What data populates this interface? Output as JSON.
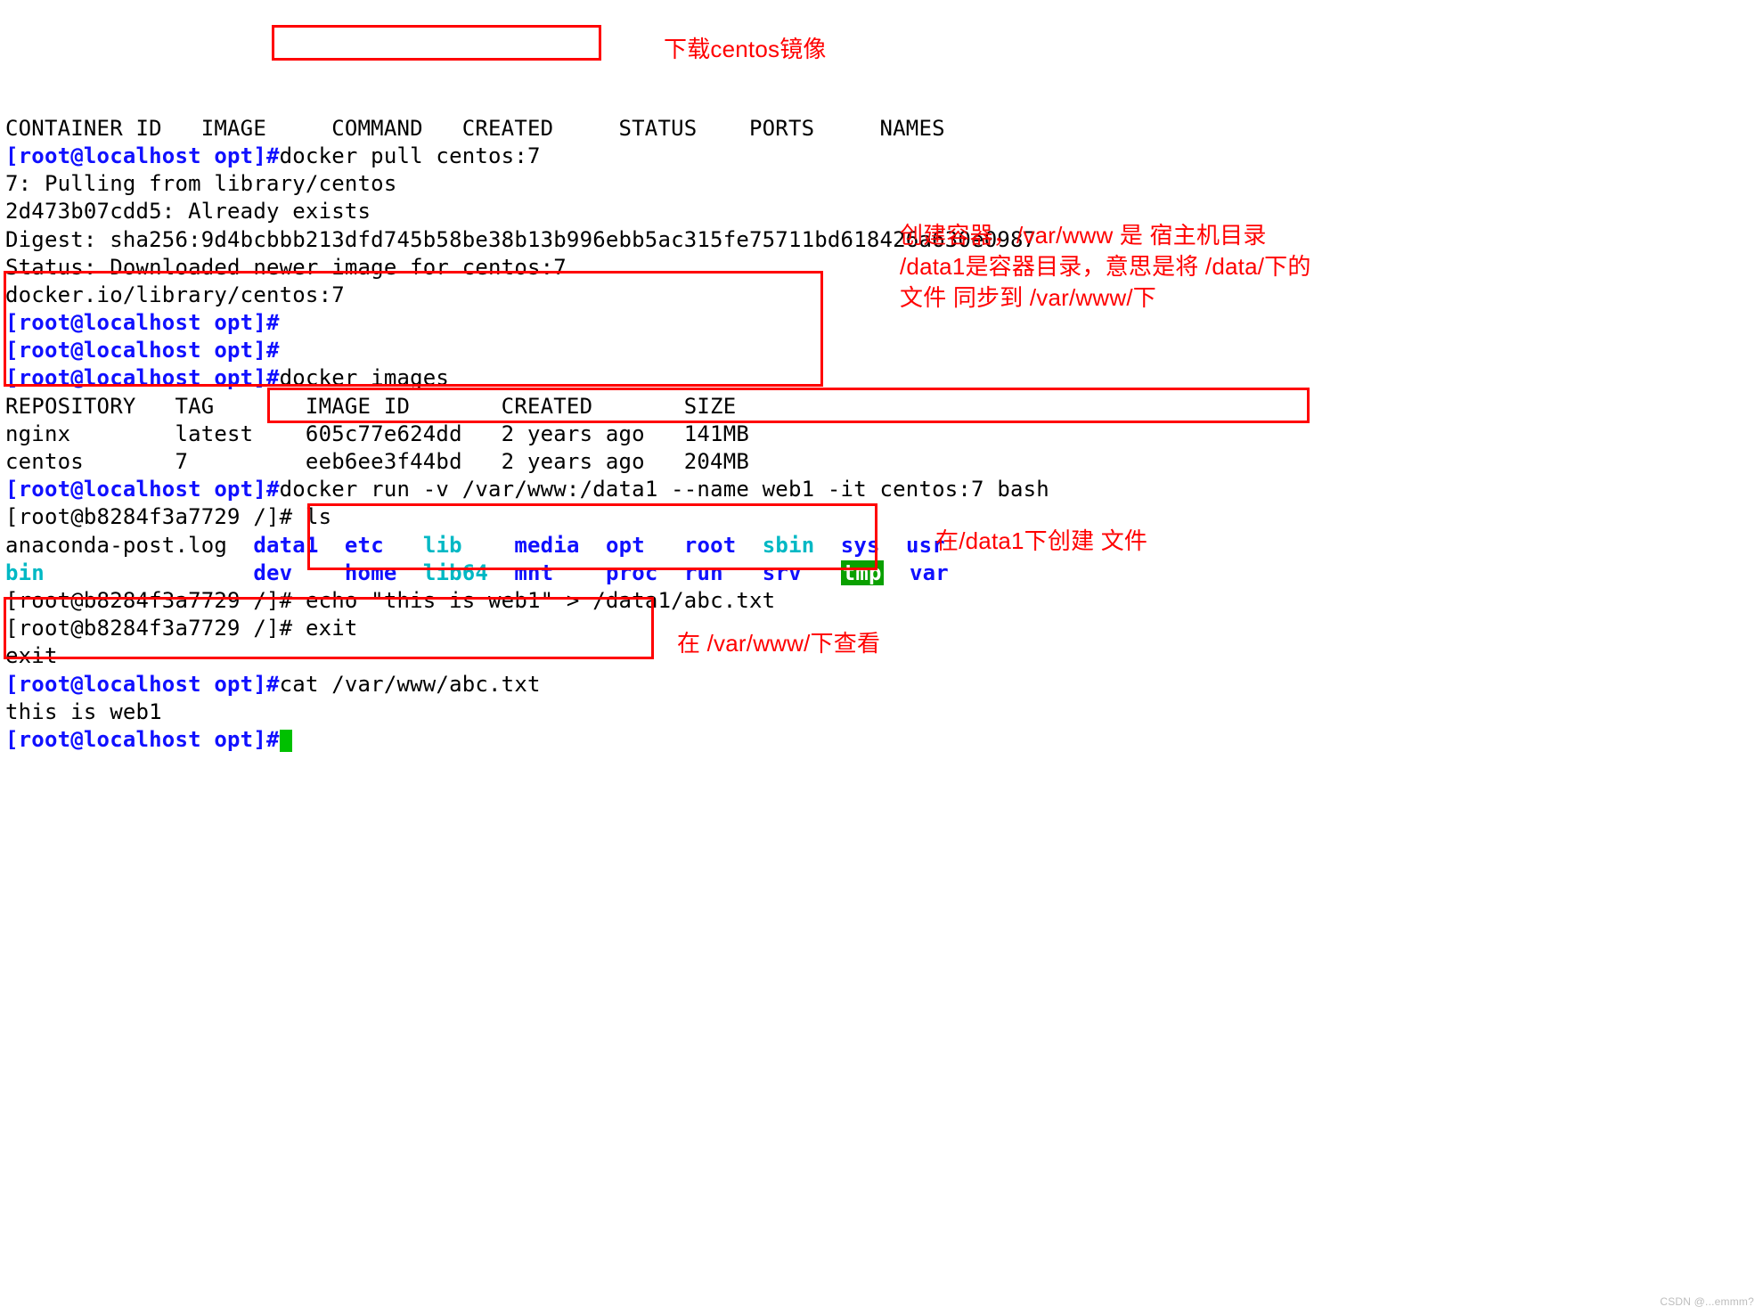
{
  "header": "CONTAINER ID   IMAGE     COMMAND   CREATED     STATUS    PORTS     NAMES",
  "prompt_local": "[root@localhost opt]#",
  "prompt_ctn": "[root@b8284f3a7729 /]# ",
  "cmd_pull": "docker pull centos:7",
  "out_pull1": "7: Pulling from library/centos",
  "out_pull2": "2d473b07cdd5: Already exists",
  "out_pull3": "Digest: sha256:9d4bcbbb213dfd745b58be38b13b996ebb5ac315fe75711bd618426a630e0987",
  "out_pull4": "Status: Downloaded newer image for centos:7",
  "out_pull5": "docker.io/library/centos:7",
  "cmd_images": "docker images",
  "img_hdr": "REPOSITORY   TAG       IMAGE ID       CREATED       SIZE",
  "img_r1": "nginx        latest    605c77e624dd   2 years ago   141MB",
  "img_r2": "centos       7         eeb6ee3f44bd   2 years ago   204MB",
  "cmd_run": "docker run -v /var/www:/data1 --name web1 -it centos:7 bash",
  "cmd_ls": "ls",
  "ls_plain1": "anaconda-post.log  ",
  "dirs1": [
    "data1",
    "etc"
  ],
  "cyan1": "lib",
  "dirs1b": [
    "media",
    "opt",
    "root"
  ],
  "cyan2": "sbin",
  "dirs1c": [
    "sys",
    "usr"
  ],
  "bin": "bin",
  "dirs2a": [
    "dev",
    "home"
  ],
  "cyan3": "lib64",
  "dirs2b": [
    "mnt",
    "proc",
    "run",
    "srv"
  ],
  "tmp": "tmp",
  "dirs2c": [
    "var"
  ],
  "cmd_echo": "echo \"this is web1\" > /data1/abc.txt",
  "cmd_exit": "exit",
  "out_exit": "exit",
  "cmd_cat": "cat /var/www/abc.txt",
  "out_cat": "this is web1",
  "anno": {
    "pull": "下载centos镜像",
    "run": "创建容器，/var/www 是 宿主机目录 /data1是容器目录，意思是将 /data/下的文件 同步到 /var/www/下",
    "echo": "在/data1下创建 文件",
    "cat": "在 /var/www/下查看"
  },
  "watermark": "CSDN @...emmm?"
}
